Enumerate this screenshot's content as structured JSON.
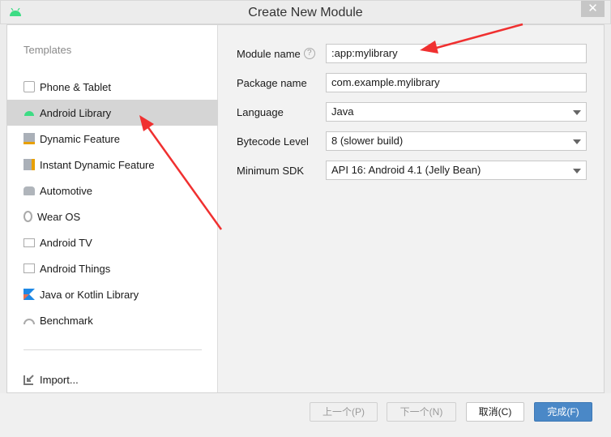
{
  "window": {
    "title": "Create New Module",
    "close": "✕"
  },
  "sidebar": {
    "heading": "Templates",
    "items": [
      {
        "label": "Phone & Tablet",
        "icon": "phone-tablet-icon"
      },
      {
        "label": "Android Library",
        "icon": "android-icon",
        "selected": true
      },
      {
        "label": "Dynamic Feature",
        "icon": "folder-feature-icon"
      },
      {
        "label": "Instant Dynamic Feature",
        "icon": "folder-instant-icon"
      },
      {
        "label": "Automotive",
        "icon": "car-icon"
      },
      {
        "label": "Wear OS",
        "icon": "watch-icon"
      },
      {
        "label": "Android TV",
        "icon": "tv-icon"
      },
      {
        "label": "Android Things",
        "icon": "things-icon"
      },
      {
        "label": "Java or Kotlin Library",
        "icon": "kotlin-icon"
      },
      {
        "label": "Benchmark",
        "icon": "gauge-icon"
      }
    ],
    "import": "Import..."
  },
  "form": {
    "module_name": {
      "label": "Module name",
      "value": ":app:mylibrary",
      "help": "?"
    },
    "package_name": {
      "label": "Package name",
      "value": "com.example.mylibrary"
    },
    "language": {
      "label": "Language",
      "value": "Java"
    },
    "bytecode": {
      "label": "Bytecode Level",
      "value": "8 (slower build)"
    },
    "min_sdk": {
      "label": "Minimum SDK",
      "value": "API 16: Android 4.1 (Jelly Bean)"
    }
  },
  "footer": {
    "prev": "上一个(P)",
    "next": "下一个(N)",
    "cancel": "取消(C)",
    "finish": "完成(F)"
  },
  "colors": {
    "accent": "#4a88c7",
    "android": "#3ddc84",
    "annotation": "#f03030"
  }
}
